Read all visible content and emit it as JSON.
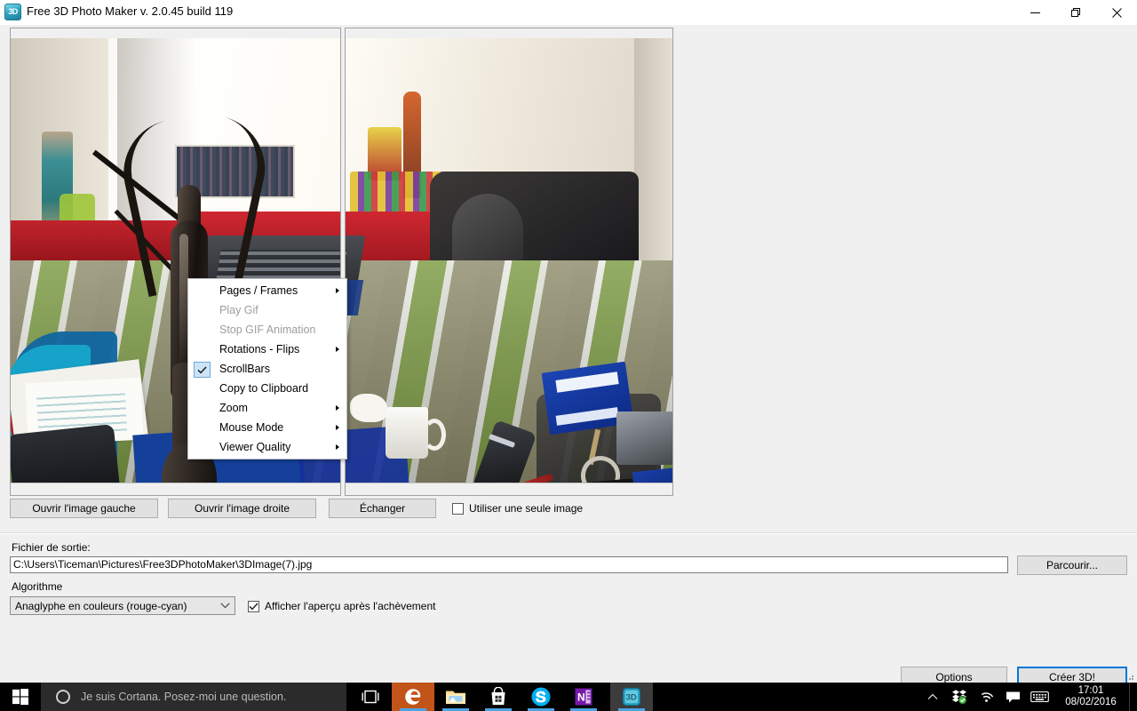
{
  "window": {
    "title": "Free 3D Photo Maker  v. 2.0.45 build 119",
    "icon_label": "3D",
    "minimize_label": "Minimize",
    "restore_label": "Restore",
    "close_label": "Close"
  },
  "panels": {
    "left_name": "left-image-preview",
    "right_name": "right-image-preview"
  },
  "context_menu": {
    "items": [
      {
        "label": "Pages / Frames",
        "submenu": true,
        "disabled": false,
        "checked": false
      },
      {
        "label": "Play Gif",
        "submenu": false,
        "disabled": true,
        "checked": false
      },
      {
        "label": "Stop GIF Animation",
        "submenu": false,
        "disabled": true,
        "checked": false
      },
      {
        "label": "Rotations - Flips",
        "submenu": true,
        "disabled": false,
        "checked": false
      },
      {
        "label": "ScrollBars",
        "submenu": false,
        "disabled": false,
        "checked": true
      },
      {
        "label": "Copy to Clipboard",
        "submenu": false,
        "disabled": false,
        "checked": false
      },
      {
        "label": "Zoom",
        "submenu": true,
        "disabled": false,
        "checked": false
      },
      {
        "label": "Mouse Mode",
        "submenu": true,
        "disabled": false,
        "checked": false
      },
      {
        "label": "Viewer Quality",
        "submenu": true,
        "disabled": false,
        "checked": false
      }
    ]
  },
  "toolbar": {
    "open_left_label": "Ouvrir l'image gauche",
    "open_right_label": "Ouvrir l'image droite",
    "swap_label": "Échanger",
    "single_image_label": "Utiliser une seule image",
    "single_image_checked": false
  },
  "output": {
    "label": "Fichier de sortie:",
    "path": "C:\\Users\\Ticeman\\Pictures\\Free3DPhotoMaker\\3DImage(7).jpg",
    "browse_label": "Parcourir..."
  },
  "algorithm": {
    "label": "Algorithme",
    "selected": "Anaglyphe en couleurs (rouge-cyan)",
    "preview_label": "Afficher l'aperçu après l'achèvement",
    "preview_checked": true
  },
  "actions": {
    "options_label": "Options",
    "create_label": "Créer 3D!"
  },
  "taskbar": {
    "start_label": "Start",
    "cortana_placeholder": "Je suis Cortana. Posez-moi une question.",
    "task_view_label": "Task View",
    "apps": [
      {
        "name": "edge",
        "label": "Microsoft Edge"
      },
      {
        "name": "file-explorer",
        "label": "Explorateur de fichiers"
      },
      {
        "name": "store",
        "label": "Windows Store"
      },
      {
        "name": "skype",
        "label": "Skype"
      },
      {
        "name": "onenote",
        "label": "OneNote"
      },
      {
        "name": "free-3d-photo-maker",
        "label": "Free 3D Photo Maker"
      }
    ],
    "tray": [
      {
        "name": "show-hidden-icons",
        "label": "Afficher les icônes masquées"
      },
      {
        "name": "dropbox",
        "label": "Dropbox"
      },
      {
        "name": "network",
        "label": "Réseau"
      },
      {
        "name": "action-center",
        "label": "Centre de notifications"
      },
      {
        "name": "touch-keyboard",
        "label": "Clavier tactile"
      }
    ],
    "clock": {
      "time": "17:01",
      "date": "08/02/2016"
    }
  },
  "colors": {
    "accent": "#0078d7",
    "window_bg": "#f0f0f0",
    "taskbar_bg": "#000000",
    "edge_tile": "#c2541a",
    "app_icon": "#31a7c4"
  }
}
